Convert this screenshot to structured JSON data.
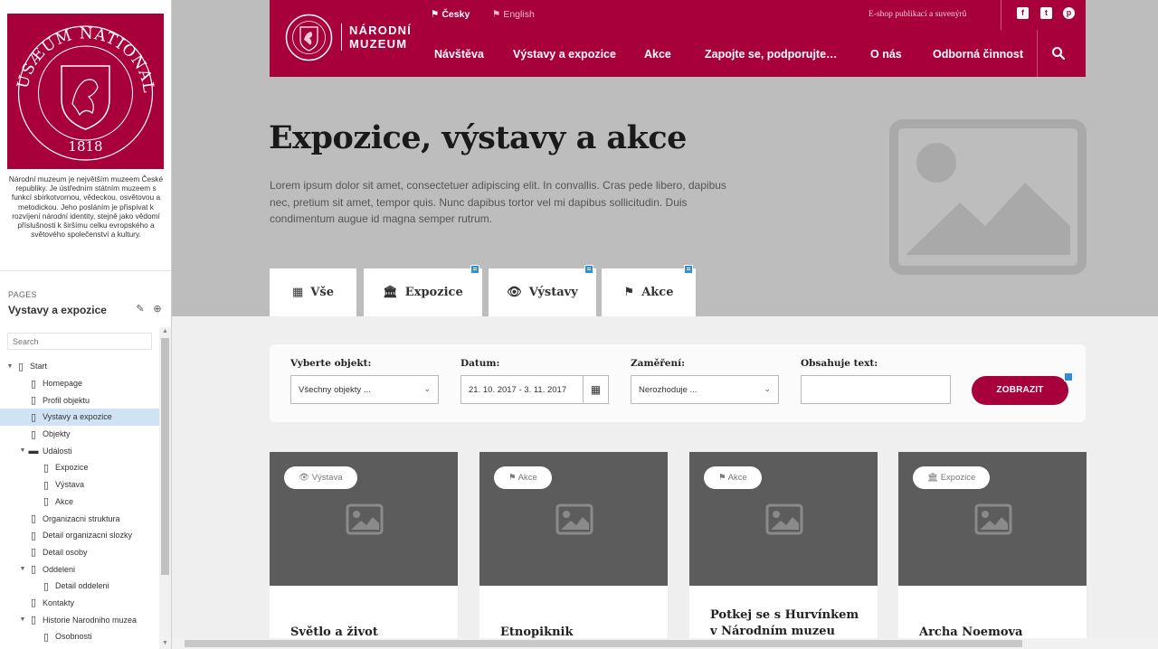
{
  "sidebar": {
    "description": "Národní muzeum je největším muzeem České republiky. Je ústředním státním muzeem s funkcí sbírkotvornou, vědeckou, osvětovou a metodickou. Jeho posláním je přispívat k rozvíjení národní identity, stejně jako vědomí příslušnosti k širšímu celku evropského a světového společenství a kultury.",
    "logo_text": "MUSÆUM NATIONALE",
    "logo_year": "1818",
    "pages_label": "PAGES",
    "pages_title": "Vystavy a expozice",
    "search_placeholder": "Search",
    "tree": [
      {
        "label": "Start",
        "level": 0,
        "icon": "page-icon",
        "expanded": true
      },
      {
        "label": "Homepage",
        "level": 1,
        "icon": "page-icon"
      },
      {
        "label": "Profil objektu",
        "level": 1,
        "icon": "page-icon"
      },
      {
        "label": "Vystavy a expozice",
        "level": 1,
        "icon": "page-icon",
        "selected": true
      },
      {
        "label": "Objekty",
        "level": 1,
        "icon": "page-icon"
      },
      {
        "label": "Události",
        "level": 1,
        "icon": "folder-icon",
        "expanded": true
      },
      {
        "label": "Expozice",
        "level": 2,
        "icon": "page-icon"
      },
      {
        "label": "Výstava",
        "level": 2,
        "icon": "page-icon"
      },
      {
        "label": "Akce",
        "level": 2,
        "icon": "page-icon"
      },
      {
        "label": "Organizacni struktura",
        "level": 1,
        "icon": "page-icon"
      },
      {
        "label": "Detail organizacni slozky",
        "level": 1,
        "icon": "page-icon"
      },
      {
        "label": "Detail osoby",
        "level": 1,
        "icon": "page-icon"
      },
      {
        "label": "Oddeleni",
        "level": 1,
        "icon": "page-icon",
        "expanded": true
      },
      {
        "label": "Detail oddeleni",
        "level": 2,
        "icon": "page-icon"
      },
      {
        "label": "Kontakty",
        "level": 1,
        "icon": "page-icon"
      },
      {
        "label": "Historie Narodniho muzea",
        "level": 1,
        "icon": "page-icon",
        "expanded": true
      },
      {
        "label": "Osobnosti",
        "level": 2,
        "icon": "page-icon"
      }
    ]
  },
  "header": {
    "brand_line1": "NÁRODNÍ",
    "brand_line2": "MUZEUM",
    "lang_cs": "Česky",
    "lang_en": "English",
    "eshop": "E-shop publikací a suvenýrů",
    "social": [
      "facebook-icon",
      "twitter-icon",
      "pinterest-icon"
    ],
    "nav": [
      "Návštěva",
      "Výstavy a expozice",
      "Akce",
      "Zapojte se, podporujte…",
      "O nás",
      "Odborná činnost"
    ],
    "accent": "#a8003b"
  },
  "hero": {
    "title": "Expozice, výstavy a akce",
    "text": "Lorem ipsum dolor sit amet, consectetuer adipiscing elit. In convallis. Cras pede libero, dapibus nec, pretium sit amet, tempor quis. Nunc dapibus tortor vel mi dapibus sollicitudin. Duis condimentum augue id magna semper rutrum."
  },
  "tabs": [
    {
      "label": "Vše",
      "icon": "grid-icon"
    },
    {
      "label": "Expozice",
      "icon": "museum-icon"
    },
    {
      "label": "Výstavy",
      "icon": "eye-icon"
    },
    {
      "label": "Akce",
      "icon": "tag-icon"
    }
  ],
  "filters": {
    "object_label": "Vyberte objekt:",
    "object_value": "Všechny objekty ...",
    "date_label": "Datum:",
    "date_value": "21. 10. 2017 - 3. 11. 2017",
    "focus_label": "Zaměření:",
    "focus_value": "Nerozhoduje ...",
    "text_label": "Obsahuje text:",
    "text_value": "",
    "submit": "ZOBRAZIT"
  },
  "cards": [
    {
      "badge": "Výstava",
      "badge_icon": "eye-icon",
      "title": "Světlo a život"
    },
    {
      "badge": "Akce",
      "badge_icon": "tag-icon",
      "title": "Etnopiknik"
    },
    {
      "badge": "Akce",
      "badge_icon": "tag-icon",
      "title": "Potkej se s Hurvínkem v Národním muzeu"
    },
    {
      "badge": "Expozice",
      "badge_icon": "museum-icon",
      "title": "Archa Noemova"
    }
  ]
}
